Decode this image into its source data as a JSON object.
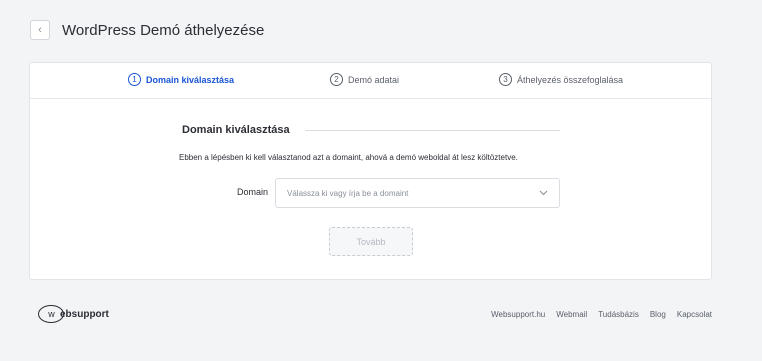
{
  "header": {
    "back_icon": "chevron-left-icon",
    "back_glyph": "‹",
    "title": "WordPress Demó áthelyezése"
  },
  "steps": [
    {
      "number": "1",
      "label": "Domain kiválasztása",
      "active": true
    },
    {
      "number": "2",
      "label": "Demó adatai",
      "active": false
    },
    {
      "number": "3",
      "label": "Áthelyezés összefoglalása",
      "active": false
    }
  ],
  "form": {
    "section_title": "Domain kiválasztása",
    "description": "Ebben a lépésben ki kell választanod azt a domaint, ahová a demó weboldal át lesz költöztetve.",
    "domain_label": "Domain",
    "domain_placeholder": "Válassza ki vagy írja be a domaint",
    "dropdown_icon": "chevron-down-icon",
    "next_label": "Tovább"
  },
  "footer": {
    "logo_mark": "w",
    "logo_text": "ebsupport",
    "links": [
      "Websupport.hu",
      "Webmail",
      "Tudásbázis",
      "Blog",
      "Kapcsolat"
    ]
  },
  "colors": {
    "accent": "#1a56d6",
    "background": "#f3f4f6",
    "card": "#ffffff"
  }
}
